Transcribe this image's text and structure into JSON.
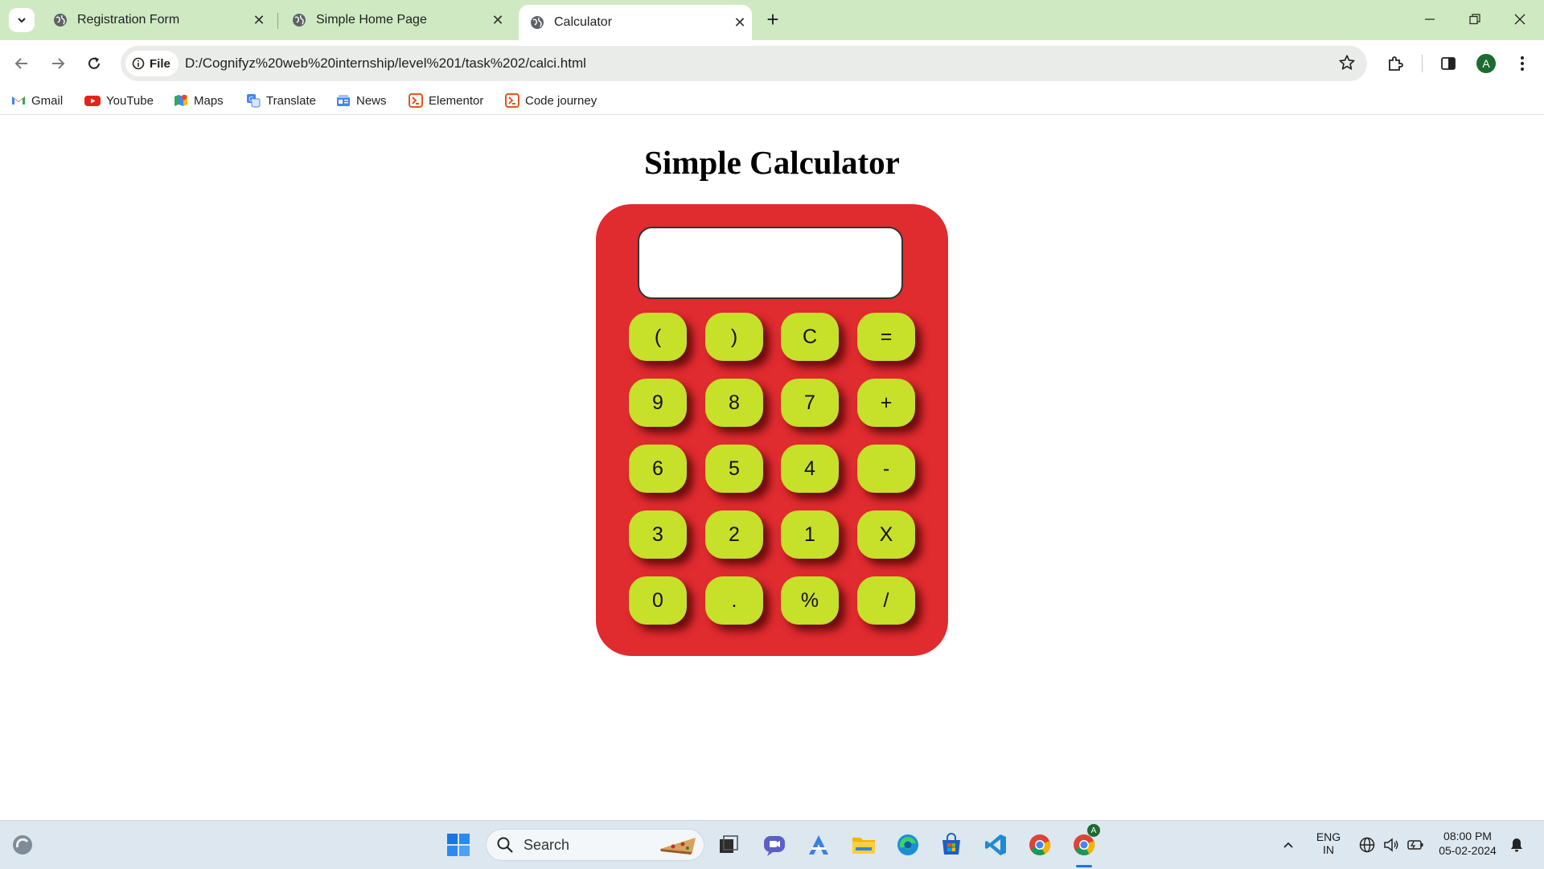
{
  "browser": {
    "tabs": [
      {
        "title": "Registration Form",
        "active": false
      },
      {
        "title": "Simple Home Page",
        "active": false
      },
      {
        "title": "Calculator",
        "active": true
      }
    ],
    "address": {
      "chip_label": "File",
      "url": "D:/Cognifyz%20web%20internship/level%201/task%202/calci.html"
    },
    "profile_initial": "A",
    "bookmarks": [
      {
        "label": "Gmail",
        "icon": "gmail-icon"
      },
      {
        "label": "YouTube",
        "icon": "youtube-icon"
      },
      {
        "label": "Maps",
        "icon": "maps-icon"
      },
      {
        "label": "Translate",
        "icon": "translate-icon"
      },
      {
        "label": "News",
        "icon": "news-icon"
      },
      {
        "label": "Elementor",
        "icon": "elementor-icon"
      },
      {
        "label": "Code journey",
        "icon": "elementor-icon"
      }
    ]
  },
  "page": {
    "title": "Simple Calculator",
    "display_value": "",
    "keys": [
      "(",
      ")",
      "C",
      "=",
      "9",
      "8",
      "7",
      "+",
      "6",
      "5",
      "4",
      "-",
      "3",
      "2",
      "1",
      "X",
      "0",
      ".",
      "%",
      "/"
    ],
    "colors": {
      "body": "#e02b2f",
      "key": "#c7e02a",
      "display": "#ffffff"
    }
  },
  "taskbar": {
    "search_placeholder": "Search",
    "lang_top": "ENG",
    "lang_bottom": "IN",
    "time": "08:00 PM",
    "date": "05-02-2024",
    "profile_badge": "A"
  }
}
